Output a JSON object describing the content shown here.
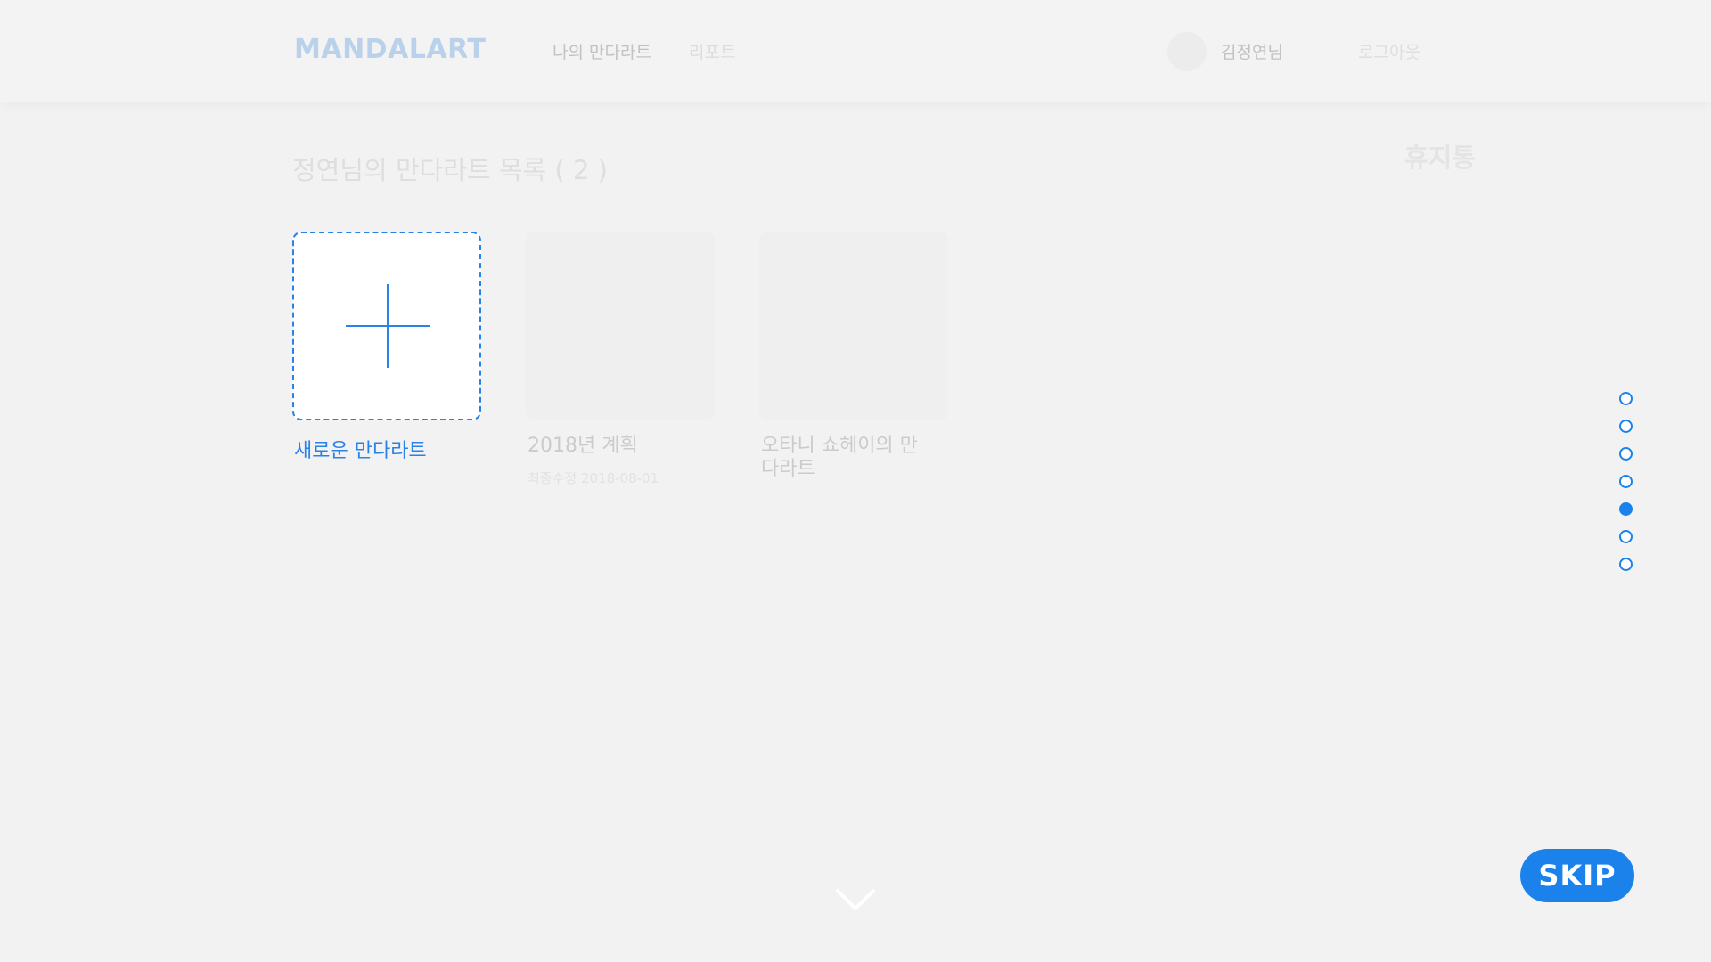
{
  "header": {
    "logo": "MANDALART",
    "nav": {
      "my_mandalart": "나의 만다라트",
      "report": "리포트"
    },
    "user": {
      "name": "김정연님"
    },
    "logout": "로그아웃"
  },
  "main": {
    "title": "정연님의 만다라트 목록 ( 2 )",
    "trash": "휴지통",
    "new_card": {
      "label": "새로운 만다라트",
      "icon": "plus-icon"
    },
    "cards": [
      {
        "title": "2018년 계획",
        "date": "최종수정 2018-08-01"
      },
      {
        "title": "오타니 쇼헤이의 만다라트"
      }
    ]
  },
  "pagination": {
    "count": 7,
    "active_index": 4
  },
  "skip_label": "SKIP",
  "scroll_icon": "chevron-down-icon",
  "colors": {
    "accent": "#1b82ec",
    "background": "#f2f2f2"
  }
}
